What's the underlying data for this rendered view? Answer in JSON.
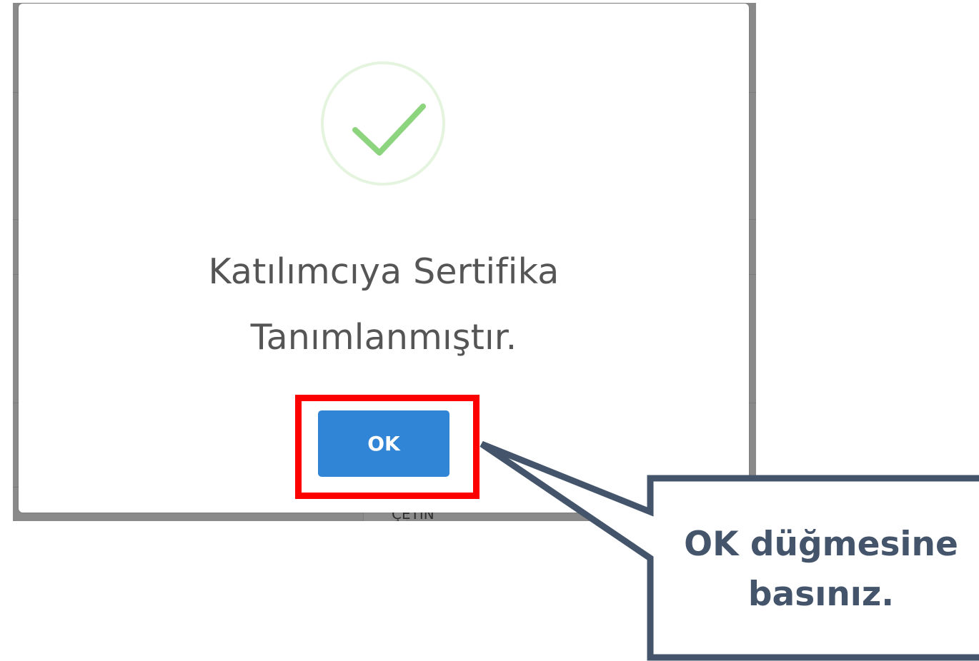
{
  "dialog": {
    "message": "Katılımcıya Sertifika Tanımlanmıştır.",
    "ok_label": "OK",
    "icon": "success-check-icon"
  },
  "callout": {
    "text": "OK düğmesine basınız."
  },
  "background": {
    "visible_fragment": "ÇETİN"
  },
  "colors": {
    "ok_button": "#3085d6",
    "check": "#8cd47e",
    "highlight": "#ff0000",
    "callout": "#44546a"
  }
}
